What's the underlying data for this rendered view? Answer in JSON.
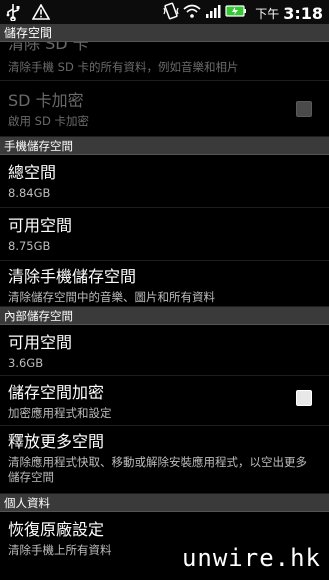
{
  "status_bar": {
    "icons_left": [
      "usb-icon",
      "warning-icon"
    ],
    "icons_right": [
      "vibrate-icon",
      "wifi-icon",
      "signal-icon",
      "battery-icon"
    ],
    "ampm": "下午",
    "time": "3:18"
  },
  "title": "儲存空間",
  "items_top": [
    {
      "title": "清除 SD 卡",
      "subtitle": "清除手機 SD 卡的所有資料，例如音樂和相片",
      "disabled": true
    },
    {
      "title": "SD 卡加密",
      "subtitle": "啟用 SD 卡加密",
      "disabled": true,
      "checkbox": false
    }
  ],
  "section_phone": "手機儲存空間",
  "items_phone": [
    {
      "title": "總空間",
      "subtitle": "8.84GB"
    },
    {
      "title": "可用空間",
      "subtitle": "8.75GB"
    },
    {
      "title": "清除手機儲存空間",
      "subtitle": "清除儲存空間中的音樂、圖片和所有資料"
    }
  ],
  "section_internal": "內部儲存空間",
  "items_internal": [
    {
      "title": "可用空間",
      "subtitle": "3.6GB"
    },
    {
      "title": "儲存空間加密",
      "subtitle": "加密應用程式和設定",
      "checkbox": true
    },
    {
      "title": "釋放更多空間",
      "subtitle": "清除應用程式快取、移動或解除安裝應用程式，以空出更多儲存空間"
    }
  ],
  "section_personal": "個人資料",
  "items_personal": [
    {
      "title": "恢復原廠設定",
      "subtitle": "清除手機上所有資料"
    }
  ],
  "watermark": "unwire.hk",
  "colors": {
    "section_bg": "#3a3a3a",
    "battery": "#37c837"
  }
}
